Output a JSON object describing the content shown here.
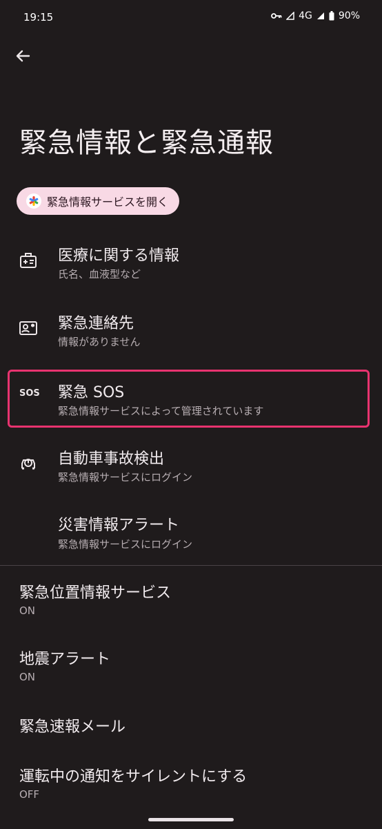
{
  "status": {
    "time": "19:15",
    "network": "4G",
    "battery": "90%"
  },
  "page_title": "緊急情報と緊急通報",
  "chip_label": "緊急情報サービスを開く",
  "items": [
    {
      "title": "医療に関する情報",
      "subtitle": "氏名、血液型など",
      "icon": "medical-info-icon"
    },
    {
      "title": "緊急連絡先",
      "subtitle": "情報がありません",
      "icon": "contact-card-icon"
    },
    {
      "title": "緊急 SOS",
      "subtitle": "緊急情報サービスによって管理されています",
      "icon": "sos-icon",
      "icon_text": "SOS"
    },
    {
      "title": "自動車事故検出",
      "subtitle": "緊急情報サービスにログイン",
      "icon": "car-crash-icon"
    },
    {
      "title": "災害情報アラート",
      "subtitle": "緊急情報サービスにログイン"
    }
  ],
  "settings": [
    {
      "title": "緊急位置情報サービス",
      "value": "ON"
    },
    {
      "title": "地震アラート",
      "value": "ON"
    },
    {
      "title": "緊急速報メール"
    },
    {
      "title": "運転中の通知をサイレントにする",
      "value": "OFF"
    }
  ],
  "colors": {
    "background": "#1f1b1c",
    "chip": "#f8d9e5",
    "highlight": "#e8336f"
  }
}
